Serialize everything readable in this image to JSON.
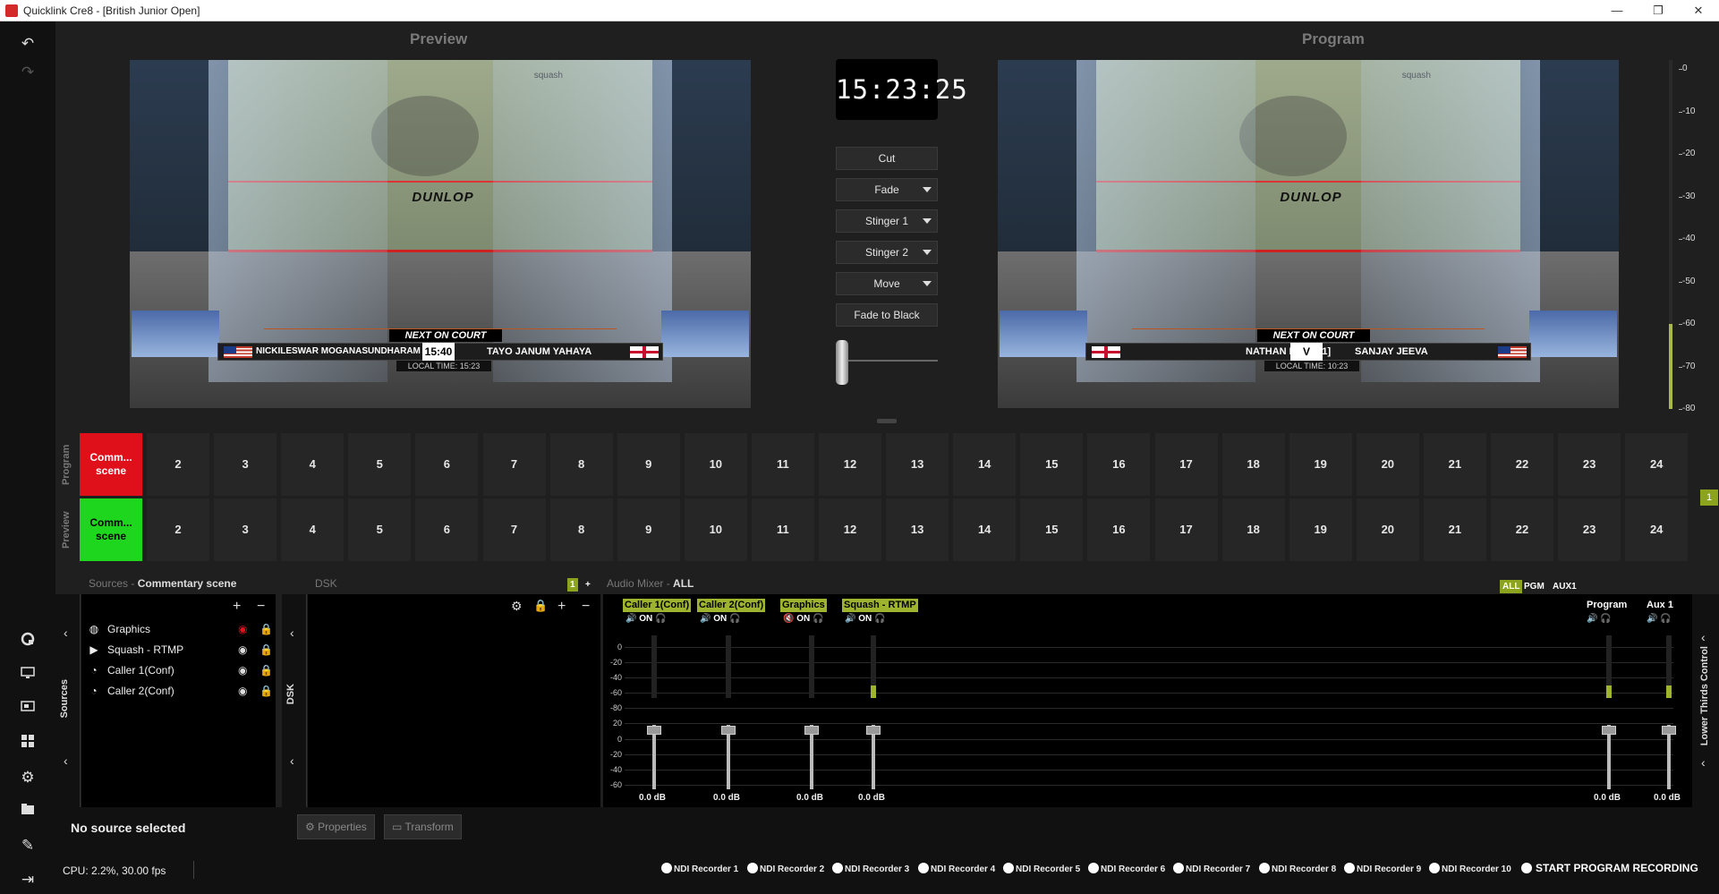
{
  "window": {
    "title": "Quicklink Cre8  - [British Junior Open]",
    "minimize": "—",
    "maximize": "❐",
    "close": "✕"
  },
  "sidebar": {
    "undo": "↶",
    "redo": "↷"
  },
  "preview": {
    "label": "Preview",
    "lower_third": {
      "tag": "NEXT ON COURT",
      "player_left": "NICKILESWAR MOGANASUNDHARAM",
      "center": "15:40",
      "player_right": "TAYO JANUM YAHAYA",
      "local_time": "LOCAL TIME:  15:23"
    },
    "brand": "DUNLOP",
    "sponsor": "squash"
  },
  "program": {
    "label": "Program",
    "lower_third": {
      "tag": "NEXT ON COURT",
      "player_left": "NATHAN LAKE [1]",
      "center": "V",
      "player_right": "SANJAY JEEVA",
      "local_time": "LOCAL TIME:  10:23"
    },
    "brand": "DUNLOP",
    "sponsor": "squash"
  },
  "transition": {
    "clock": "15:23:25",
    "buttons": {
      "cut": "Cut",
      "fade": "Fade",
      "stinger1": "Stinger 1",
      "stinger2": "Stinger 2",
      "move": "Move",
      "ftb": "Fade to Black"
    }
  },
  "vu_meter": {
    "labels": [
      "0",
      "-10",
      "-20",
      "-30",
      "-40",
      "-50",
      "-60",
      "-70",
      "-80"
    ],
    "level_color": "#a8b94a"
  },
  "scenes": {
    "program_label": "Program",
    "preview_label": "Preview",
    "first_line1": "Comm...",
    "first_line2": "scene",
    "numbers": [
      "2",
      "3",
      "4",
      "5",
      "6",
      "7",
      "8",
      "9",
      "10",
      "11",
      "12",
      "13",
      "14",
      "15",
      "16",
      "17",
      "18",
      "19",
      "20",
      "21",
      "22",
      "23",
      "24"
    ],
    "program_active_color": "#e0101b",
    "preview_active_color": "#1fd61f",
    "badge": "1"
  },
  "sources": {
    "header_label": "Sources  -",
    "scene_name": "Commentary scene",
    "side_label": "Sources",
    "items": [
      {
        "icon": "globe-icon",
        "name": "Graphics",
        "hidden": true
      },
      {
        "icon": "play-icon",
        "name": "Squash - RTMP",
        "hidden": false
      },
      {
        "icon": "quicklink-icon",
        "name": "Caller 1(Conf)",
        "hidden": false
      },
      {
        "icon": "quicklink-icon",
        "name": "Caller 2(Conf)",
        "hidden": false
      }
    ]
  },
  "dsk": {
    "header_label": "DSK",
    "side_label": "DSK",
    "badge": "1",
    "add": "+"
  },
  "audio_mixer": {
    "header_label": "Audio Mixer  -",
    "filter": "ALL",
    "modes": [
      "ALL",
      "PGM",
      "AUX1"
    ],
    "on_label": "ON",
    "scale": [
      "0",
      "-20",
      "-40",
      "-60",
      "-80",
      "20",
      "0",
      "-20",
      "-40",
      "-60"
    ],
    "channels": [
      {
        "name": "Caller 1(Conf)",
        "db": "0.0 dB",
        "muted": false
      },
      {
        "name": "Caller 2(Conf)",
        "db": "0.0 dB",
        "muted": false
      },
      {
        "name": "Graphics",
        "db": "0.0 dB",
        "muted": true
      },
      {
        "name": "Squash - RTMP",
        "db": "0.0 dB",
        "muted": false
      }
    ],
    "outputs": [
      {
        "name": "Program",
        "db": "0.0 dB"
      },
      {
        "name": "Aux 1",
        "db": "0.0 dB"
      }
    ]
  },
  "lower_thirds": {
    "side_label": "Lower Thirds Control"
  },
  "status": {
    "no_source": "No source selected",
    "properties": "Properties",
    "transform": "Transform",
    "cpu": "CPU: 2.2%, 30.00 fps",
    "recorders": [
      "NDI Recorder 1",
      "NDI Recorder 2",
      "NDI Recorder 3",
      "NDI Recorder 4",
      "NDI Recorder 5",
      "NDI Recorder 6",
      "NDI Recorder 7",
      "NDI Recorder 8",
      "NDI Recorder 9",
      "NDI Recorder 10"
    ],
    "start_recording": "START PROGRAM RECORDING"
  }
}
